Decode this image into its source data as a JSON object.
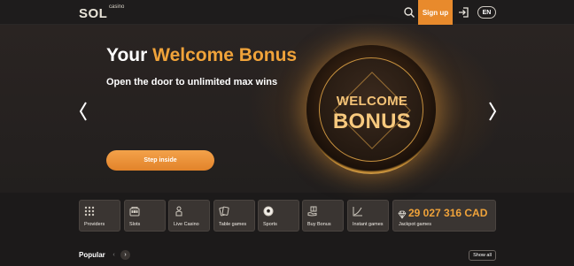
{
  "header": {
    "logo_text": "SOL",
    "logo_sub": "casino",
    "signup_label": "Sign up",
    "lang_label": "EN",
    "search_icon": "search-icon",
    "login_icon": "login-icon"
  },
  "hero": {
    "title_prefix": "Your ",
    "title_accent": "Welcome Bonus",
    "subtitle": "Open the door to unlimited max wins",
    "cta_label": "Step inside",
    "coin_line1": "WELCOME",
    "coin_line2": "BONUS"
  },
  "categories": [
    {
      "label": "Providers",
      "icon": "grid-dots-icon"
    },
    {
      "label": "Slots",
      "icon": "slot-machine-icon"
    },
    {
      "label": "Live Casino",
      "icon": "dealer-icon"
    },
    {
      "label": "Table games",
      "icon": "cards-icon"
    },
    {
      "label": "Sports",
      "icon": "soccer-ball-icon"
    },
    {
      "label": "Buy Bonus",
      "icon": "gift-hand-icon"
    },
    {
      "label": "Instant games",
      "icon": "chart-line-icon"
    }
  ],
  "jackpot": {
    "amount": "29 027 316 CAD",
    "label": "Jackpot games",
    "icon": "diamond-icon"
  },
  "popular": {
    "title": "Popular",
    "prev": "‹",
    "next": "›",
    "show_all": "Show all"
  },
  "colors": {
    "accent": "#f0a33a",
    "signup_bg": "#e88a2c",
    "background": "#1c1a1a",
    "tile_bg": "#3a3532"
  }
}
